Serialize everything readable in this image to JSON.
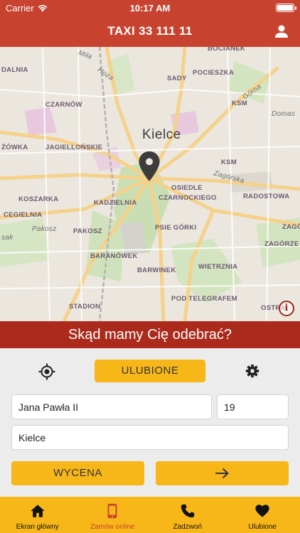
{
  "status_bar": {
    "carrier": "Carrier",
    "time": "10:17 AM"
  },
  "header": {
    "title": "TAXI 33 111 11"
  },
  "map": {
    "city": "Kielce",
    "labels": [
      "BOCIANEK",
      "DALNIA",
      "SADY",
      "POCIESZKA",
      "CZARNÓW",
      "KSM",
      "ŻÓWKA",
      "JAGIELLOŃSKIE",
      "KSM",
      "KOSZARKA",
      "KADZIELNIA",
      "OSIEDLE",
      "CZARNOCKIEGO",
      "RADOSTOWA",
      "CEGIELNIA",
      "PSIE GÓRKI",
      "ZAGÓ",
      "PAKOSZ",
      "ZAGÓRZE",
      "BARANÓWEK",
      "WIETRZNIA",
      "BARWINEK",
      "STADION",
      "POD TELEGRAFEM",
      "OSTRA"
    ],
    "streets": [
      "Miła",
      "Hoża",
      "Górna",
      "Domas",
      "Zagórska",
      "Pakosz",
      "sak"
    ]
  },
  "prompt": "Skąd mamy Cię odebrać?",
  "form": {
    "favorites_label": "ULUBIONE",
    "street_value": "Jana Pawła II",
    "number_value": "19",
    "city_value": "Kielce",
    "quote_label": "WYCENA"
  },
  "tabs": [
    {
      "label": "Ekran główny",
      "icon": "home-icon"
    },
    {
      "label": "Zamów online",
      "icon": "phone-online-icon"
    },
    {
      "label": "Zadzwoń",
      "icon": "phone-call-icon"
    },
    {
      "label": "Ulubione",
      "icon": "heart-icon"
    }
  ],
  "colors": {
    "header": "#c7432f",
    "banner": "#ab2a1c",
    "accent": "#f7b718",
    "active_tab": "#c7432f"
  }
}
